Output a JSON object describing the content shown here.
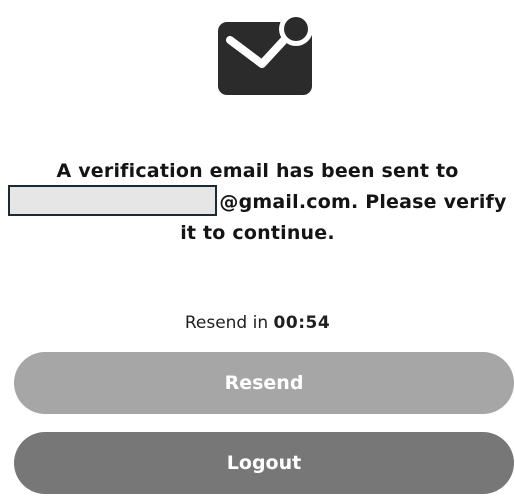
{
  "icon": "mail-notification-icon",
  "message": {
    "line1": "A verification email has been sent to",
    "line2_suffix": "@gmail.com. Please verify",
    "line3": "it to continue."
  },
  "resend": {
    "prefix": "Resend in ",
    "countdown": "00:54"
  },
  "buttons": {
    "resend_label": "Resend",
    "logout_label": "Logout"
  },
  "colors": {
    "icon": "#2b2b2b",
    "resend_button": "#a6a6a6",
    "logout_button": "#777777",
    "redaction_fill": "#e6e6e6",
    "redaction_border": "#1c2b33"
  }
}
